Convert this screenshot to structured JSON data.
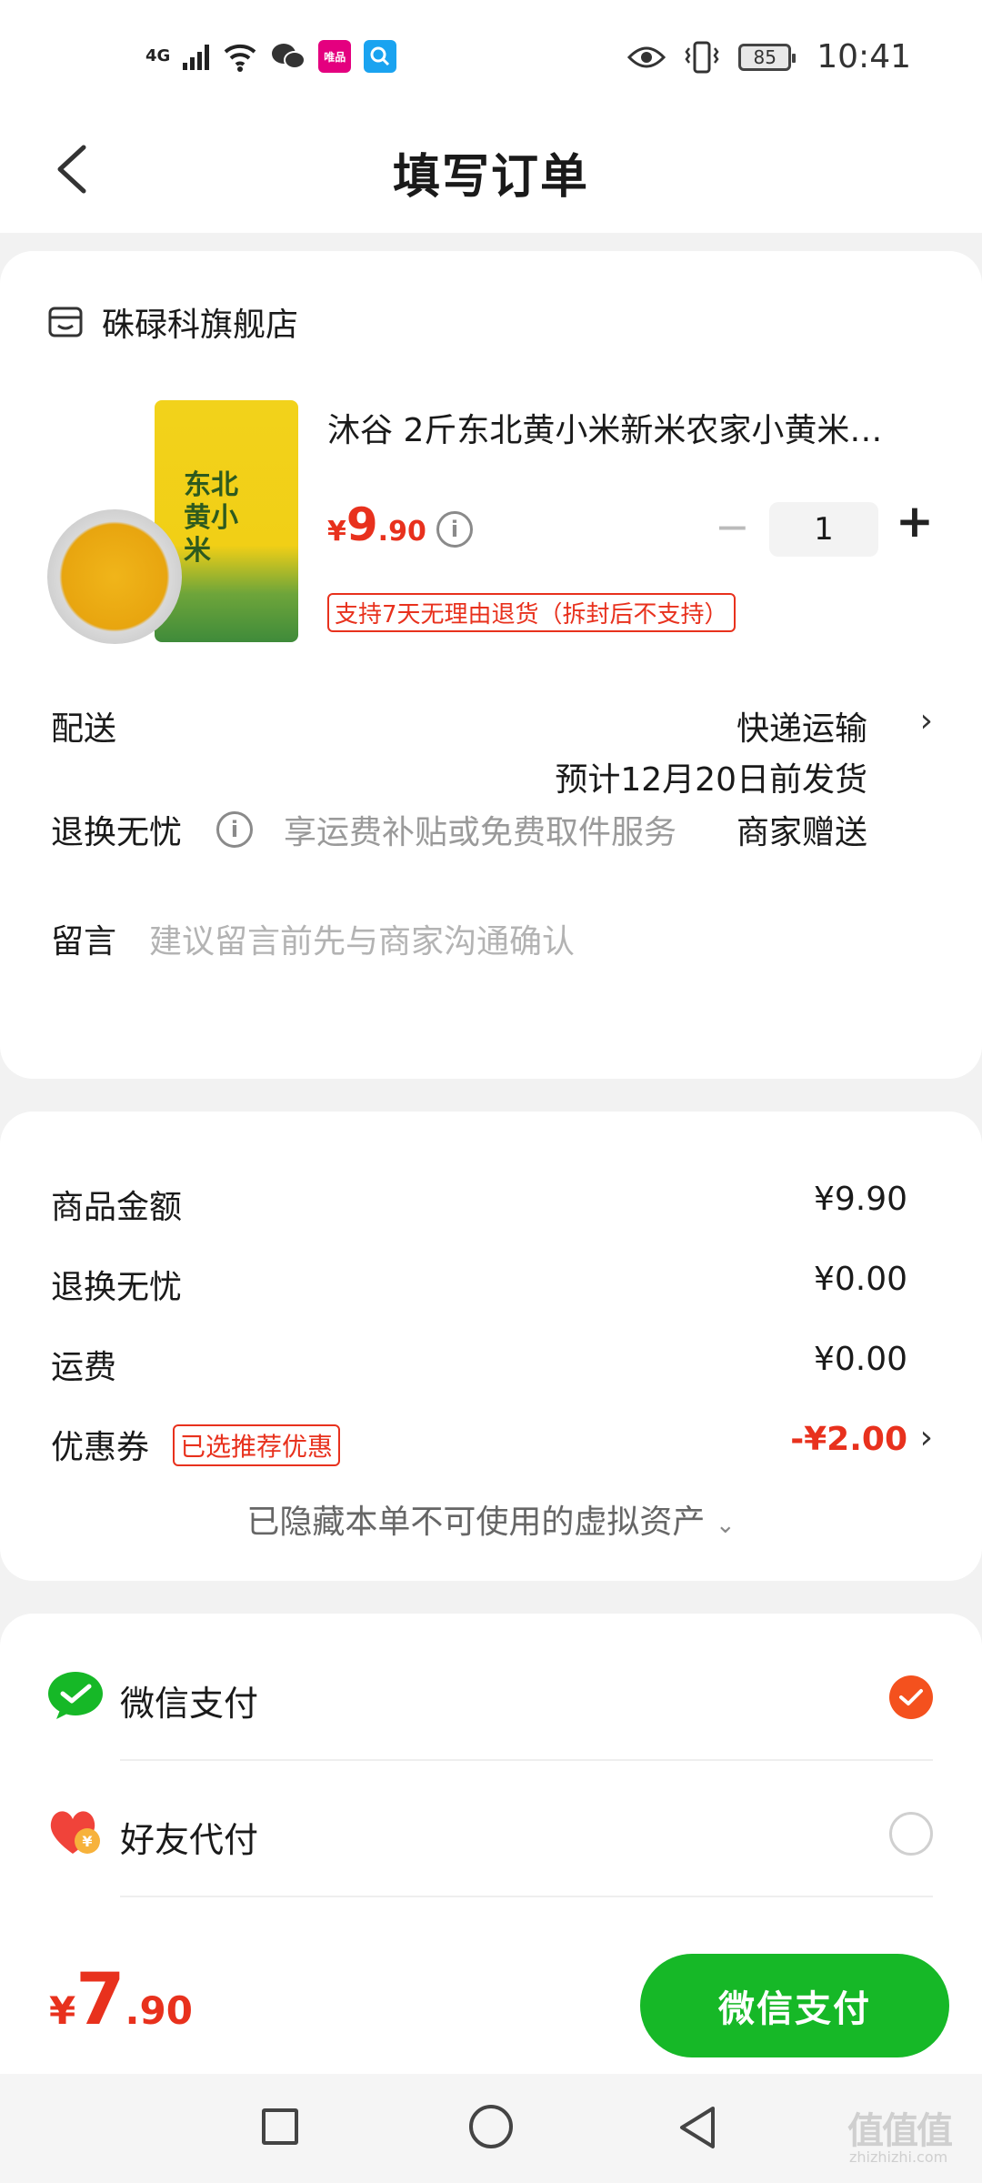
{
  "status_bar": {
    "network": "4G",
    "battery": "85",
    "time": "10:41",
    "icons": [
      "signal-icon",
      "wifi-icon",
      "wechat-icon",
      "vip-app-icon",
      "search-app-icon",
      "eye-icon",
      "vibrate-icon",
      "battery-icon"
    ]
  },
  "header": {
    "title": "填写订单"
  },
  "order": {
    "store_name": "硃碌科旗舰店",
    "product": {
      "title": "沐谷 2斤东北黄小米新米农家小黄米…",
      "package_text": "东北黄小米",
      "price_symbol": "¥",
      "price_int": "9",
      "price_dec": ".90",
      "return_tag": "支持7天无理由退货（拆封后不支持）",
      "quantity": "1",
      "minus": "−",
      "plus": "+"
    },
    "delivery": {
      "label": "配送",
      "method": "快递运输",
      "eta": "预计12月20日前发货"
    },
    "return_worry": {
      "label": "退换无忧",
      "desc": "享运费补贴或免费取件服务",
      "value": "商家赠送"
    },
    "message": {
      "label": "留言",
      "placeholder": "建议留言前先与商家沟通确认"
    }
  },
  "summary": {
    "goods_label": "商品金额",
    "goods_value": "¥9.90",
    "return_label": "退换无忧",
    "return_value": "¥0.00",
    "shipping_label": "运费",
    "shipping_value": "¥0.00",
    "coupon_label": "优惠券",
    "coupon_tag": "已选推荐优惠",
    "coupon_value": "-¥2.00",
    "hidden_assets": "已隐藏本单不可使用的虚拟资产"
  },
  "payment": {
    "wechat_label": "微信支付",
    "wechat_selected": true,
    "friend_label": "好友代付",
    "friend_selected": false
  },
  "bottom": {
    "total_symbol": "¥",
    "total_int": "7",
    "total_dec": ".90",
    "pay_button": "微信支付"
  },
  "watermark": "值值值",
  "watermark_url": "zhizhizhi.com",
  "colors": {
    "accent_green": "#16b827",
    "price_red": "#e8311d",
    "check_orange": "#f4511e"
  }
}
